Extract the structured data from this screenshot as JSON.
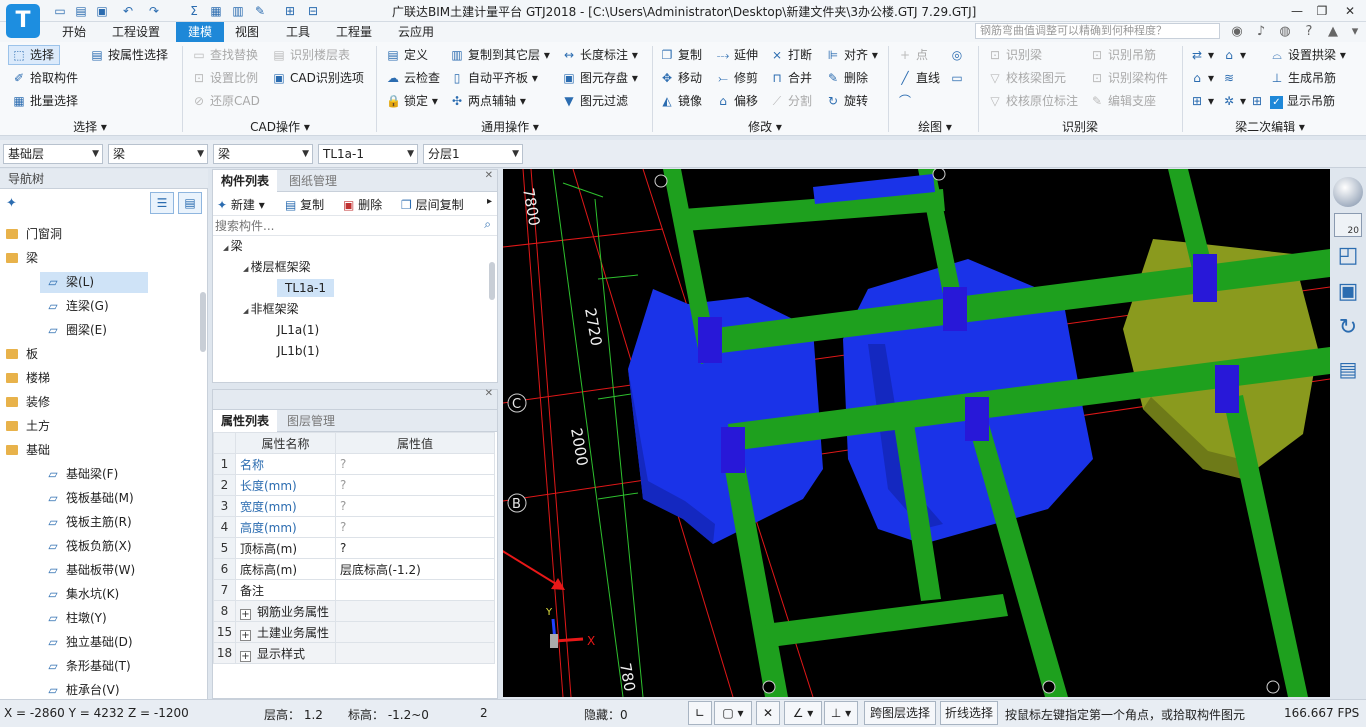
{
  "app": {
    "logo": "T",
    "title": "广联达BIM土建计量平台 GTJ2018 - [C:\\Users\\Administrator\\Desktop\\新建文件夹\\3办公楼.GTJ 7.29.GTJ]",
    "quick_access": [
      "new-icon",
      "open-icon",
      "save-icon",
      "undo-icon",
      "redo-icon",
      "sum-icon",
      "calc-icon",
      "report-icon",
      "pencil-icon",
      "grid-icon",
      "table-icon"
    ],
    "window_controls": [
      "minimize-icon",
      "restore-icon",
      "close-icon"
    ]
  },
  "menu": {
    "tabs": [
      "开始",
      "工程设置",
      "建模",
      "视图",
      "工具",
      "工程量",
      "云应用"
    ],
    "active": "建模",
    "search_placeholder": "钢筋弯曲值调整可以精确到何种程度？"
  },
  "ribbon": {
    "select": {
      "items": [
        "选择",
        "按属性选择",
        "拾取构件",
        "批量选择"
      ],
      "label": "选择"
    },
    "cad": {
      "items": [
        "查找替换",
        "识别楼层表",
        "设置比例",
        "CAD识别选项",
        "还原CAD"
      ],
      "label": "CAD操作"
    },
    "general": {
      "items": [
        "定义",
        "复制到其它层",
        "长度标注",
        "云检查",
        "自动平齐板",
        "图元存盘",
        "锁定",
        "两点辅轴",
        "图元过滤"
      ],
      "label": "通用操作"
    },
    "modify": {
      "items": [
        "复制",
        "延伸",
        "打断",
        "对齐",
        "移动",
        "修剪",
        "合并",
        "删除",
        "镜像",
        "偏移",
        "分割",
        "旋转"
      ],
      "label": "修改"
    },
    "draw": {
      "items": [
        "点",
        "直线"
      ],
      "label": "绘图"
    },
    "recognize_beam": {
      "items": [
        "识别梁",
        "识别吊筋",
        "校核梁图元",
        "识别梁构件",
        "校核原位标注",
        "编辑支座"
      ],
      "label": "识别梁"
    },
    "beam_edit": {
      "items": [
        "设置拱梁",
        "生成吊筋",
        "显示吊筋"
      ],
      "label": "梁二次编辑"
    }
  },
  "filters": {
    "floor": "基础层",
    "category": "梁",
    "type": "梁",
    "component": "TL1a-1",
    "layer": "分层1"
  },
  "nav": {
    "title": "导航树",
    "items": [
      {
        "label": "门窗洞",
        "level": 0
      },
      {
        "label": "梁",
        "level": 0
      },
      {
        "label": "梁(L)",
        "level": 1,
        "icon": "beam-icon",
        "selected": true
      },
      {
        "label": "连梁(G)",
        "level": 1,
        "icon": "link-beam-icon"
      },
      {
        "label": "圈梁(E)",
        "level": 1,
        "icon": "ring-beam-icon"
      },
      {
        "label": "板",
        "level": 0
      },
      {
        "label": "楼梯",
        "level": 0
      },
      {
        "label": "装修",
        "level": 0
      },
      {
        "label": "土方",
        "level": 0
      },
      {
        "label": "基础",
        "level": 0
      },
      {
        "label": "基础梁(F)",
        "level": 1,
        "icon": "foundation-beam-icon"
      },
      {
        "label": "筏板基础(M)",
        "level": 1,
        "icon": "raft-icon"
      },
      {
        "label": "筏板主筋(R)",
        "level": 1,
        "icon": "rebar-icon"
      },
      {
        "label": "筏板负筋(X)",
        "level": 1,
        "icon": "neg-rebar-icon"
      },
      {
        "label": "基础板带(W)",
        "level": 1,
        "icon": "strip-icon"
      },
      {
        "label": "集水坑(K)",
        "level": 1,
        "icon": "sump-icon"
      },
      {
        "label": "柱墩(Y)",
        "level": 1,
        "icon": "pier-icon"
      },
      {
        "label": "独立基础(D)",
        "level": 1,
        "icon": "isolated-icon"
      },
      {
        "label": "条形基础(T)",
        "level": 1,
        "icon": "strip-foundation-icon"
      },
      {
        "label": "桩承台(V)",
        "level": 1,
        "icon": "pile-cap-icon"
      }
    ]
  },
  "component_list": {
    "tabs": [
      "构件列表",
      "图纸管理"
    ],
    "toolbar": [
      "新建",
      "复制",
      "删除",
      "层间复制"
    ],
    "search_placeholder": "搜索构件...",
    "tree": [
      {
        "label": "梁",
        "level": 0
      },
      {
        "label": "楼层框架梁",
        "level": 1
      },
      {
        "label": "TL1a-1",
        "level": 2,
        "selected": true
      },
      {
        "label": "非框架梁",
        "level": 1
      },
      {
        "label": "JL1a(1)",
        "level": 2
      },
      {
        "label": "JL1b(1)",
        "level": 2
      }
    ]
  },
  "properties": {
    "tabs": [
      "属性列表",
      "图层管理"
    ],
    "headers": [
      "属性名称",
      "属性值"
    ],
    "rows": [
      {
        "num": "1",
        "name": "名称",
        "value": "?",
        "blue": true
      },
      {
        "num": "2",
        "name": "长度(mm)",
        "value": "?",
        "blue": true
      },
      {
        "num": "3",
        "name": "宽度(mm)",
        "value": "?",
        "blue": true
      },
      {
        "num": "4",
        "name": "高度(mm)",
        "value": "?",
        "blue": true
      },
      {
        "num": "5",
        "name": "顶标高(m)",
        "value": "?"
      },
      {
        "num": "6",
        "name": "底标高(m)",
        "value": "层底标高(-1.2)"
      },
      {
        "num": "7",
        "name": "备注",
        "value": ""
      },
      {
        "num": "8",
        "name": "钢筋业务属性",
        "value": "",
        "group": true
      },
      {
        "num": "15",
        "name": "土建业务属性",
        "value": "",
        "group": true
      },
      {
        "num": "18",
        "name": "显示样式",
        "value": "",
        "group": true
      }
    ]
  },
  "viewport": {
    "dimensions": [
      "7800",
      "2720",
      "2000",
      "780"
    ],
    "axis_labels": [
      "C",
      "B",
      "B"
    ],
    "axes": {
      "x": "X",
      "y": "Y"
    },
    "colors": {
      "beam": "#1ea01e",
      "raft": "#1e3cff",
      "olive": "#8a9a1e",
      "column": "#2818d8",
      "grid": "#e01818"
    }
  },
  "status": {
    "coords": "X = -2860 Y = 4232 Z = -1200",
    "floor_height": "层高： 1.2",
    "elevation": "标高： -1.2~0",
    "count": "2",
    "hidden": "隐藏：0",
    "cross_layer": "跨图层选择",
    "polyline": "折线选择",
    "hint": "按鼠标左键指定第一个角点，或拾取构件图元",
    "fps": "166.667 FPS"
  }
}
